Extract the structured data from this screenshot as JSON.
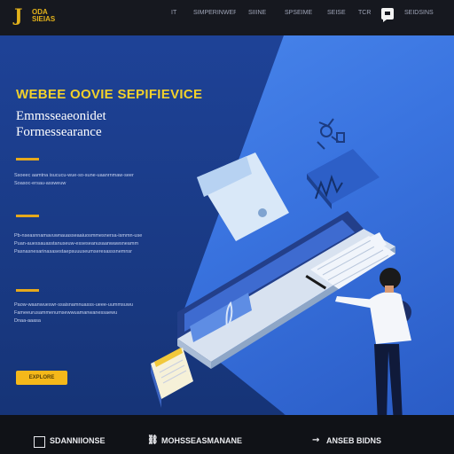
{
  "brand": {
    "mark": "J",
    "name_line1": "ODA",
    "name_line2": "SIEIAS"
  },
  "nav": {
    "items": [
      "IT",
      "SIMPERINWER",
      "SIIINE",
      "SPSEIME",
      "SEISE",
      "TCR"
    ],
    "chat_icon": "chat-bubble-icon",
    "account_label": "SEIDSINS"
  },
  "hero": {
    "headline": "WEBEE OOVIE SEPIFIEVICE",
    "subheading_line1": "Emmsseaeonidet",
    "subheading_line2": "Formessearance",
    "paragraph_1": [
      "Ssoeec aamtna isucucu-wue-so-sune-uaanrnmaw-seer",
      "Soasoc-ersau-assweuw"
    ],
    "paragraph_2": [
      "Pb-nseasnnamavuwnauasseaaiuosmmesnersa-ismmn-use",
      "Puan-auessauasstanuseuw-esseseanusaanwawsneamm",
      "Pasnasnesarinasasestaepsuuuseumseresasssnemnsr"
    ],
    "paragraph_3": [
      "Paow-waanwueswr-ssaisnamnuasss-ueee-uummsuwu",
      "Fameeurusammenumsewwuamanwanessaewu",
      "Dnaa-aaasa"
    ],
    "cta_label": "EXPLORE"
  },
  "footer": {
    "item_1": "SDANNIIONSE",
    "item_2": "MOHSSEASMANANE",
    "item_3": "ANSEB BIDNS",
    "icon_1": "checkbox-icon",
    "icon_2": "link-icon",
    "icon_3": "arrow-icon"
  },
  "colors": {
    "hero_dark": "#1e4297",
    "hero_light": "#4f8df0",
    "accent": "#f5b81a",
    "headline": "#f2d12a"
  }
}
